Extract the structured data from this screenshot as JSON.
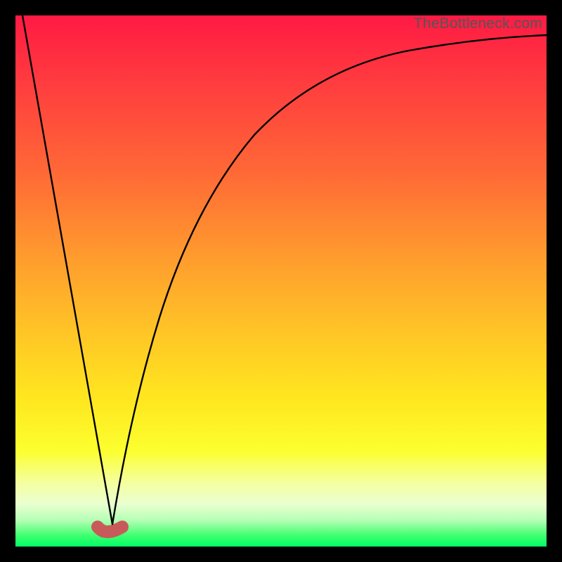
{
  "watermark": "TheBottleneck.com",
  "chart_data": {
    "type": "line",
    "title": "",
    "xlabel": "",
    "ylabel": "",
    "x": [
      0,
      5,
      10,
      14,
      16,
      17,
      18,
      19,
      20,
      22,
      25,
      30,
      35,
      40,
      45,
      50,
      55,
      60,
      65,
      70,
      75,
      80,
      85,
      90,
      95,
      100
    ],
    "values": [
      100,
      72,
      44,
      22,
      10,
      5,
      2,
      1,
      3,
      12,
      30,
      52,
      65,
      73,
      79,
      83,
      86,
      88.5,
      90.2,
      91.5,
      92.5,
      93.3,
      93.9,
      94.4,
      94.7,
      95
    ],
    "xlim": [
      0,
      100
    ],
    "ylim": [
      0,
      100
    ],
    "marker": {
      "x": [
        16.5,
        19.5
      ],
      "y": [
        1,
        1
      ]
    },
    "notes": "V-shaped bottleneck curve on red-yellow-green gradient; minimum near x≈18. No axes or tick labels are rendered."
  }
}
